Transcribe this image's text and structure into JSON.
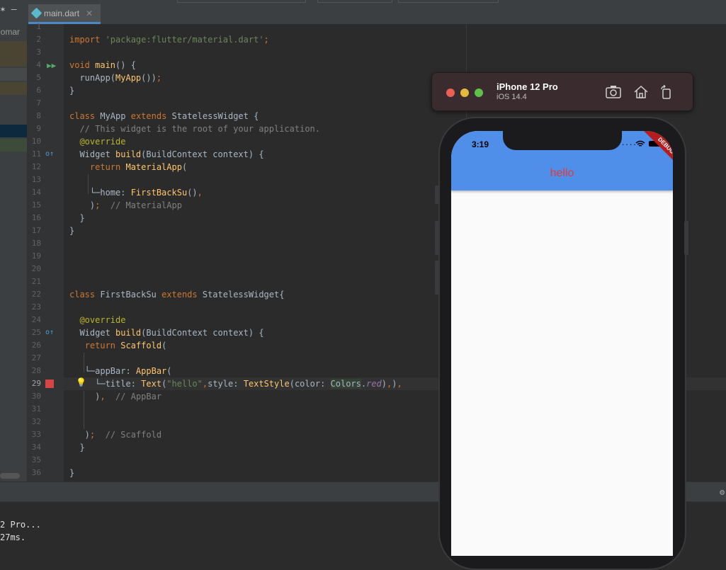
{
  "editor_tab": {
    "filename": "main.dart",
    "close": "✕"
  },
  "project_panel": {
    "partial_label": "lomar"
  },
  "code": {
    "lines": [
      "1",
      "2",
      "3",
      "4",
      "5",
      "6",
      "7",
      "8",
      "9",
      "10",
      "11",
      "12",
      "13",
      "14",
      "15",
      "16",
      "17",
      "18",
      "19",
      "20",
      "21",
      "22",
      "23",
      "24",
      "25",
      "26",
      "27",
      "28",
      "29",
      "30",
      "31",
      "32",
      "33",
      "34",
      "35",
      "36"
    ],
    "current_line": "29"
  },
  "simulator": {
    "device": "iPhone 12 Pro",
    "os": "iOS 14.4",
    "screenshot_icon": "camera-icon",
    "home_icon": "home-icon",
    "rotate_icon": "rotate-icon"
  },
  "app": {
    "time": "3:19",
    "title": "hello",
    "banner": "DEBUG",
    "appbar_color": "#4f8fea",
    "title_color": "#e53935"
  },
  "console": {
    "line1": "2 Pro...",
    "line2": "27ms."
  },
  "colors": {
    "keyword": "#cc7832",
    "string": "#6a8759",
    "function": "#ffc66d",
    "comment": "#808080",
    "annotation": "#bbb529"
  }
}
